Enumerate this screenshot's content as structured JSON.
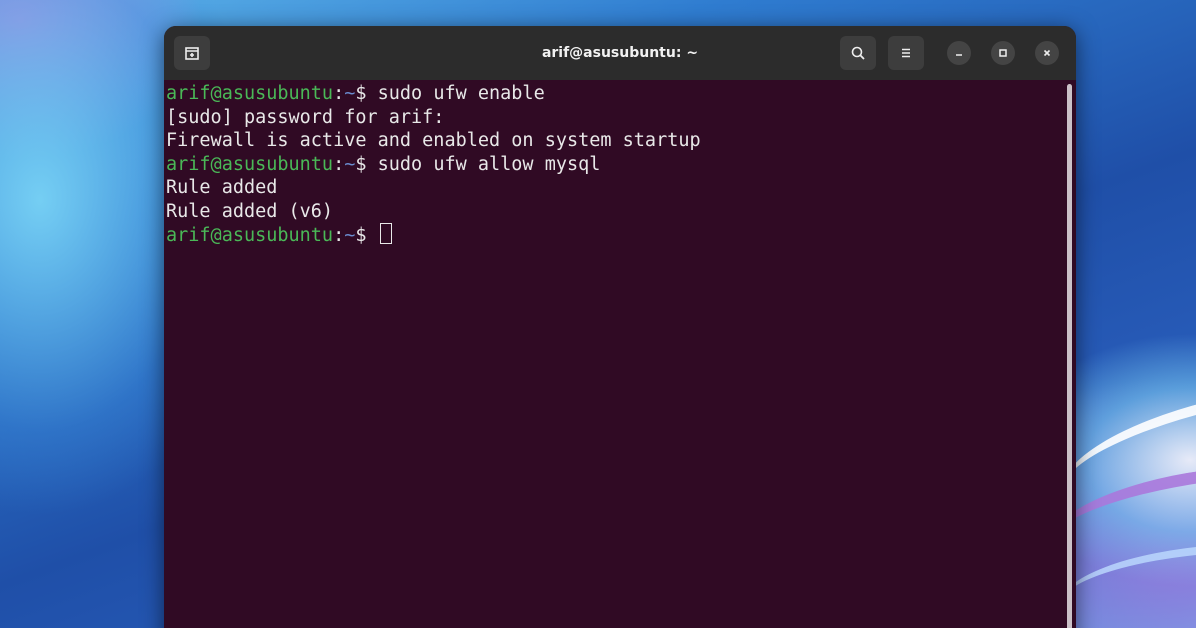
{
  "window": {
    "title": "arif@asusubuntu: ~"
  },
  "header_buttons": {
    "new_tab_icon": "new-tab-icon",
    "search_icon": "search-icon",
    "menu_icon": "hamburger-menu-icon",
    "minimize_icon": "minimize-icon",
    "maximize_icon": "maximize-icon",
    "close_icon": "close-icon"
  },
  "terminal": {
    "lines": [
      {
        "type": "prompt",
        "user": "arif@asusubuntu",
        "sep": ":",
        "path": "~",
        "symbol": "$ ",
        "command": "sudo ufw enable"
      },
      {
        "type": "output",
        "text": "[sudo] password for arif:"
      },
      {
        "type": "output",
        "text": "Firewall is active and enabled on system startup"
      },
      {
        "type": "prompt",
        "user": "arif@asusubuntu",
        "sep": ":",
        "path": "~",
        "symbol": "$ ",
        "command": "sudo ufw allow mysql"
      },
      {
        "type": "output",
        "text": "Rule added"
      },
      {
        "type": "output",
        "text": "Rule added (v6)"
      },
      {
        "type": "prompt",
        "user": "arif@asusubuntu",
        "sep": ":",
        "path": "~",
        "symbol": "$ ",
        "command": ""
      }
    ]
  },
  "colors": {
    "terminal_background": "#300a24",
    "prompt_user": "#4ab857",
    "prompt_path": "#6a8ccf",
    "text": "#e8e8e8",
    "headerbar": "#2c2c2c"
  }
}
